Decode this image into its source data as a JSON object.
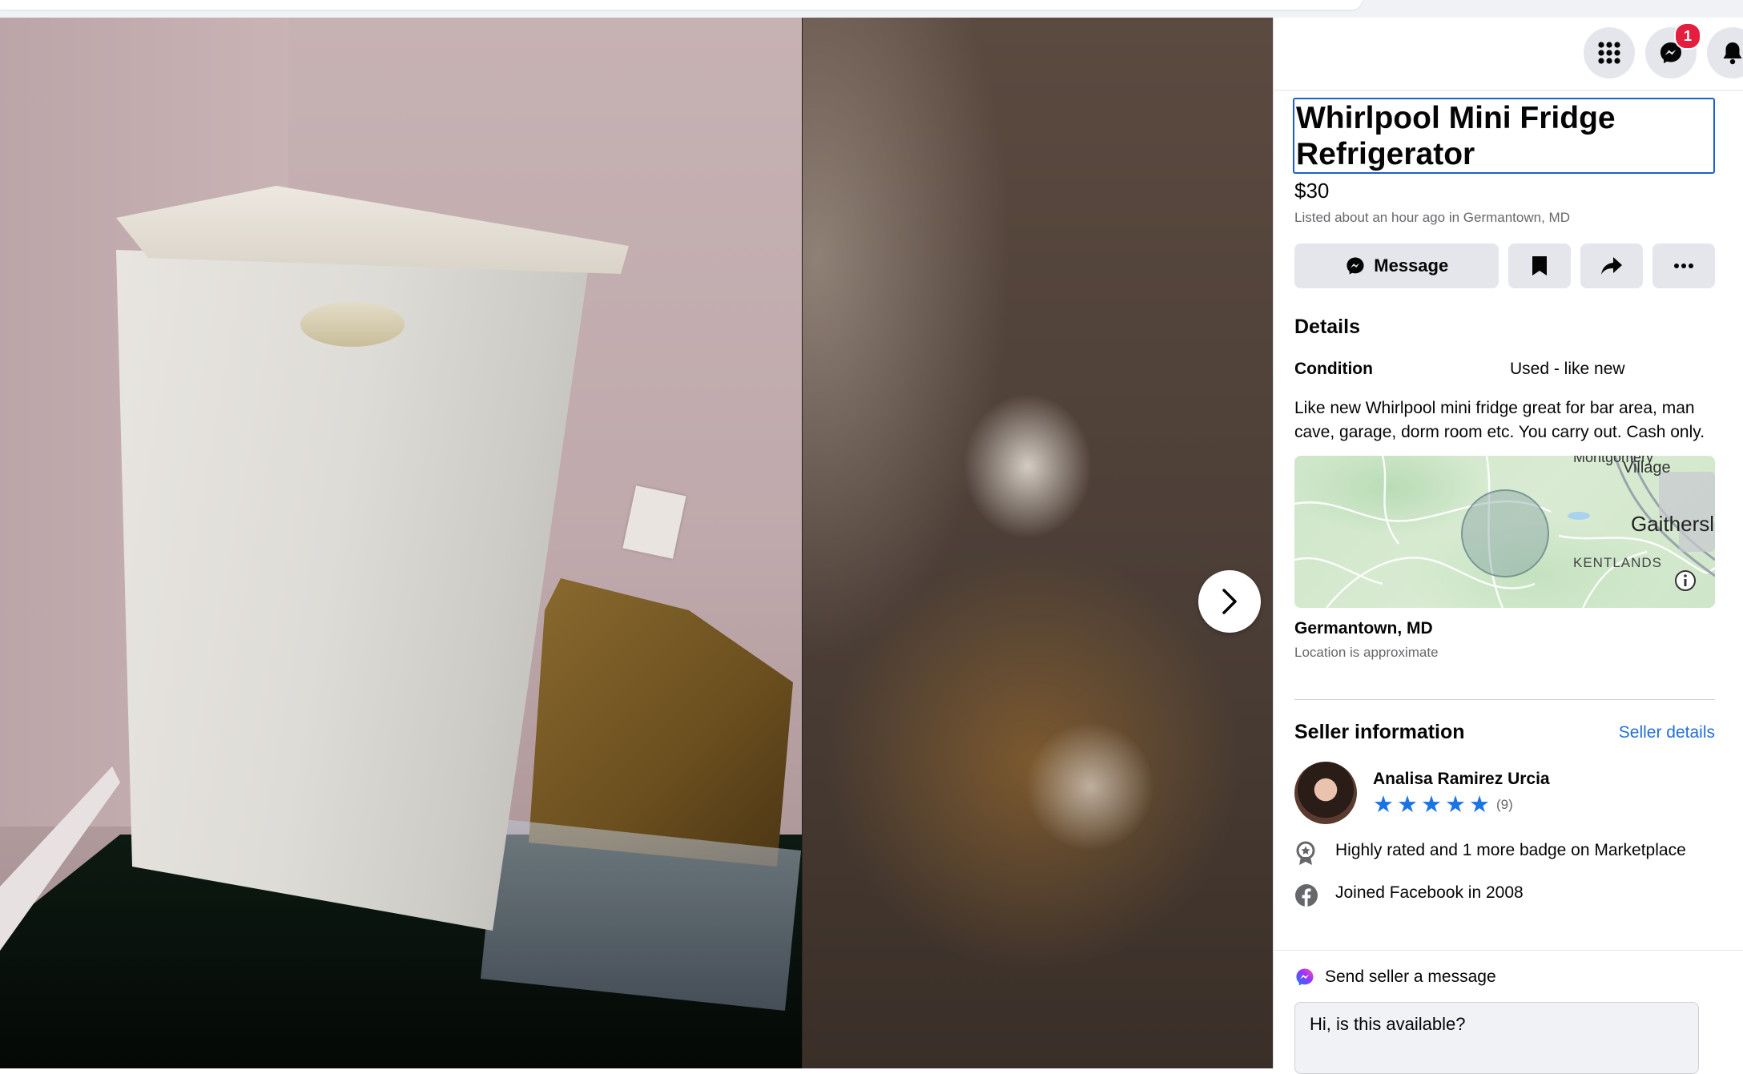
{
  "header": {
    "icons": [
      "menu-grid-icon",
      "messenger-icon",
      "notifications-bell-icon"
    ],
    "messenger_badge": "1"
  },
  "viewer": {
    "next_icon": "chevron-right-icon"
  },
  "listing": {
    "title_line1": "Whirlpool Mini Fridge",
    "title_line2": "Refrigerator",
    "price": "$30",
    "listed": "Listed about an hour ago in Germantown, MD",
    "message_label": "Message",
    "details_heading": "Details",
    "condition_label": "Condition",
    "condition_value": "Used - like new",
    "description": "Like new Whirlpool mini fridge great for bar area, man cave, garage, dorm room etc. You carry out. Cash only.",
    "map": {
      "labels": [
        "Village",
        "Gaithersl",
        "KENTLANDS"
      ],
      "top_partial": "Montgomery"
    },
    "location_name": "Germantown, MD",
    "location_note": "Location is approximate"
  },
  "seller": {
    "heading": "Seller information",
    "details_link": "Seller details",
    "name": "Analisa Ramirez Urcia",
    "rating_stars": 5,
    "rating_count": "(9)",
    "badge_text": "Highly rated and 1 more badge on Marketplace",
    "joined_text": "Joined Facebook in 2008"
  },
  "footer": {
    "send_label": "Send seller a message",
    "message_value": "Hi, is this available?"
  },
  "colors": {
    "accent": "#1b74e4",
    "link": "#216fdb",
    "notification": "#e41e3f",
    "button_bg": "#e4e6eb"
  }
}
